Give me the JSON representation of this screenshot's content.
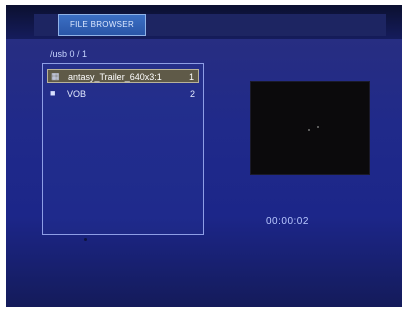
{
  "header": {
    "tab_label": "FILE BROWSER"
  },
  "path": {
    "label": "/usb",
    "position": "0 / 1"
  },
  "file_list": [
    {
      "icon": "film-icon",
      "name": "antasy_Trailer_640x3:1",
      "count": "1",
      "selected": true
    },
    {
      "icon": "folder-icon",
      "name": "VOB",
      "count": "2",
      "selected": false
    }
  ],
  "preview": {
    "timestamp": "00:00:02"
  },
  "colors": {
    "background": "#202a8a",
    "tab": "#2a56a8",
    "selection": "#5f5a48"
  }
}
